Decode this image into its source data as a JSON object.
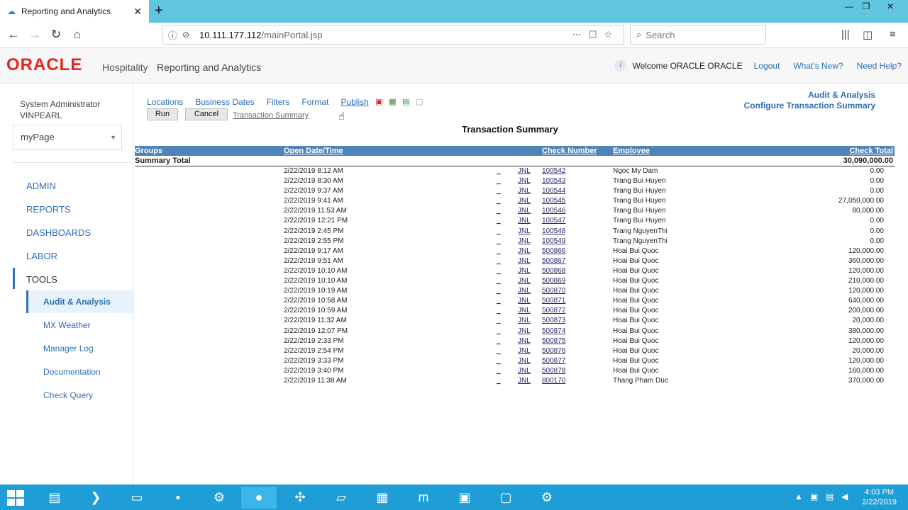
{
  "browser": {
    "tab_title": "Reporting and Analytics",
    "url_host": "10.111.177.112",
    "url_path": "/mainPortal.jsp",
    "search_placeholder": "Search"
  },
  "header": {
    "logo": "ORACLE",
    "brand_sub": "Hospitality",
    "app_name": "Reporting and Analytics",
    "welcome": "Welcome ORACLE ORACLE",
    "links": {
      "logout": "Logout",
      "whats_new": "What's New?",
      "need_help": "Need Help?"
    }
  },
  "sidebar": {
    "user_line1": "System Administrator",
    "user_line2": "VINPEARL",
    "page_select": "myPage",
    "nav": {
      "admin": "ADMIN",
      "reports": "REPORTS",
      "dashboards": "DASHBOARDS",
      "labor": "LABOR",
      "tools": "TOOLS"
    },
    "sub": {
      "audit": "Audit & Analysis",
      "mx_weather": "MX Weather",
      "manager_log": "Manager Log",
      "documentation": "Documentation",
      "check_query": "Check Query"
    }
  },
  "content": {
    "links": {
      "locations": "Locations",
      "business_dates": "Business Dates",
      "filters": "Filters",
      "format": "Format",
      "publish": "Publish"
    },
    "buttons": {
      "run": "Run",
      "cancel": "Cancel"
    },
    "breadcrumb": "Transaction Summary",
    "right_title_1": "Audit & Analysis",
    "right_title_2": "Configure Transaction Summary",
    "report_title": "Transaction Summary",
    "columns": {
      "groups": "Groups",
      "open_date": "Open Date/Time",
      "check_number": "Check Number",
      "employee": "Employee",
      "check_total": "Check Total"
    },
    "summary_label": "Summary Total",
    "summary_total": "30,090,000.00",
    "rows": [
      {
        "date": "2/22/2019 8:12 AM",
        "dash": "_",
        "jnl": "JNL",
        "check": "100542",
        "employee": "Ngoc My Dam",
        "total": "0.00"
      },
      {
        "date": "2/22/2019 8:30 AM",
        "dash": "_",
        "jnl": "JNL",
        "check": "100543",
        "employee": "Trang Bui Huyen",
        "total": "0.00"
      },
      {
        "date": "2/22/2019 9:37 AM",
        "dash": "_",
        "jnl": "JNL",
        "check": "100544",
        "employee": "Trang Bui Huyen",
        "total": "0.00"
      },
      {
        "date": "2/22/2019 9:41 AM",
        "dash": "_",
        "jnl": "JNL",
        "check": "100545",
        "employee": "Trang Bui Huyen",
        "total": "27,050,000.00"
      },
      {
        "date": "2/22/2019 11:53 AM",
        "dash": "_",
        "jnl": "JNL",
        "check": "100546",
        "employee": "Trang Bui Huyen",
        "total": "80,000.00"
      },
      {
        "date": "2/22/2019 12:21 PM",
        "dash": "_",
        "jnl": "JNL",
        "check": "100547",
        "employee": "Trang Bui Huyen",
        "total": "0.00"
      },
      {
        "date": "2/22/2019 2:45 PM",
        "dash": "_",
        "jnl": "JNL",
        "check": "100548",
        "employee": "Trang NguyenThi",
        "total": "0.00"
      },
      {
        "date": "2/22/2019 2:55 PM",
        "dash": "_",
        "jnl": "JNL",
        "check": "100549",
        "employee": "Trang NguyenThi",
        "total": "0.00"
      },
      {
        "date": "2/22/2019 9:17 AM",
        "dash": "_",
        "jnl": "JNL",
        "check": "500866",
        "employee": "Hoai Bui Quoc",
        "total": "120,000.00"
      },
      {
        "date": "2/22/2019 9:51 AM",
        "dash": "_",
        "jnl": "JNL",
        "check": "500867",
        "employee": "Hoai Bui Quoc",
        "total": "360,000.00"
      },
      {
        "date": "2/22/2019 10:10 AM",
        "dash": "_",
        "jnl": "JNL",
        "check": "500868",
        "employee": "Hoai Bui Quoc",
        "total": "120,000.00"
      },
      {
        "date": "2/22/2019 10:10 AM",
        "dash": "_",
        "jnl": "JNL",
        "check": "500869",
        "employee": "Hoai Bui Quoc",
        "total": "210,000.00"
      },
      {
        "date": "2/22/2019 10:19 AM",
        "dash": "_",
        "jnl": "JNL",
        "check": "500870",
        "employee": "Hoai Bui Quoc",
        "total": "120,000.00"
      },
      {
        "date": "2/22/2019 10:58 AM",
        "dash": "_",
        "jnl": "JNL",
        "check": "500871",
        "employee": "Hoai Bui Quoc",
        "total": "640,000.00"
      },
      {
        "date": "2/22/2019 10:59 AM",
        "dash": "_",
        "jnl": "JNL",
        "check": "500872",
        "employee": "Hoai Bui Quoc",
        "total": "200,000.00"
      },
      {
        "date": "2/22/2019 11:32 AM",
        "dash": "_",
        "jnl": "JNL",
        "check": "500873",
        "employee": "Hoai Bui Quoc",
        "total": "20,000.00"
      },
      {
        "date": "2/22/2019 12:07 PM",
        "dash": "_",
        "jnl": "JNL",
        "check": "500874",
        "employee": "Hoai Bui Quoc",
        "total": "380,000.00"
      },
      {
        "date": "2/22/2019 2:33 PM",
        "dash": "_",
        "jnl": "JNL",
        "check": "500875",
        "employee": "Hoai Bui Quoc",
        "total": "120,000.00"
      },
      {
        "date": "2/22/2019 2:54 PM",
        "dash": "_",
        "jnl": "JNL",
        "check": "500876",
        "employee": "Hoai Bui Quoc",
        "total": "20,000.00"
      },
      {
        "date": "2/22/2019 3:33 PM",
        "dash": "_",
        "jnl": "JNL",
        "check": "500877",
        "employee": "Hoai Bui Quoc",
        "total": "120,000.00"
      },
      {
        "date": "2/22/2019 3:40 PM",
        "dash": "_",
        "jnl": "JNL",
        "check": "500878",
        "employee": "Hoai Bui Quoc",
        "total": "160,000.00"
      },
      {
        "date": "2/22/2019 11:38 AM",
        "dash": "_",
        "jnl": "JNL",
        "check": "800170",
        "employee": "Thang Pham Duc",
        "total": "370,000.00"
      }
    ]
  },
  "taskbar": {
    "time": "4:03 PM",
    "date": "2/22/2019"
  },
  "colors": {
    "tabstrip": "#60c6e0",
    "oracle_red": "#e5261c",
    "link_blue": "#2d6fb5",
    "grid_header": "#4f84b8",
    "taskbar": "#1f9dd6"
  }
}
